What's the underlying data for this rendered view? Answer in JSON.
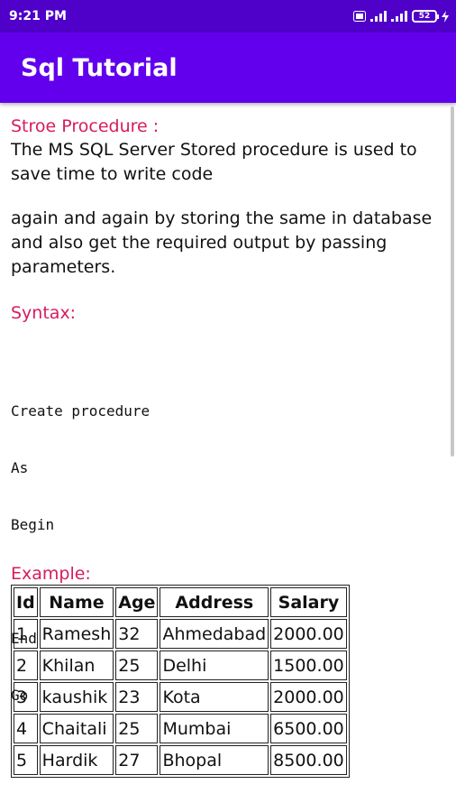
{
  "status_bar": {
    "time": "9:21 PM",
    "battery": "52"
  },
  "app_bar": {
    "title": "Sql Tutorial"
  },
  "content": {
    "heading_procedure": "Stroe Procedure :",
    "para1": "The MS SQL Server Stored procedure is used to save time to write code",
    "para2": "again and again by storing the same in database and also get the required output by passing parameters.",
    "heading_syntax": "Syntax:",
    "code": [
      "Create procedure",
      "As",
      "Begin",
      "",
      "End",
      "Go"
    ],
    "heading_example": "Example:",
    "table": {
      "headers": [
        "Id",
        "Name",
        "Age",
        "Address",
        "Salary"
      ],
      "rows": [
        [
          "1",
          "Ramesh",
          "32",
          "Ahmedabad",
          "2000.00"
        ],
        [
          "2",
          "Khilan",
          "25",
          "Delhi",
          "1500.00"
        ],
        [
          "3",
          "kaushik",
          "23",
          "Kota",
          "2000.00"
        ],
        [
          "4",
          "Chaitali",
          "25",
          "Mumbai",
          "6500.00"
        ],
        [
          "5",
          "Hardik",
          "27",
          "Bhopal",
          "8500.00"
        ]
      ]
    }
  },
  "colors": {
    "status_bar": "#4f00c9",
    "app_bar": "#6200ee",
    "heading": "#d81b60",
    "text": "#111111"
  }
}
